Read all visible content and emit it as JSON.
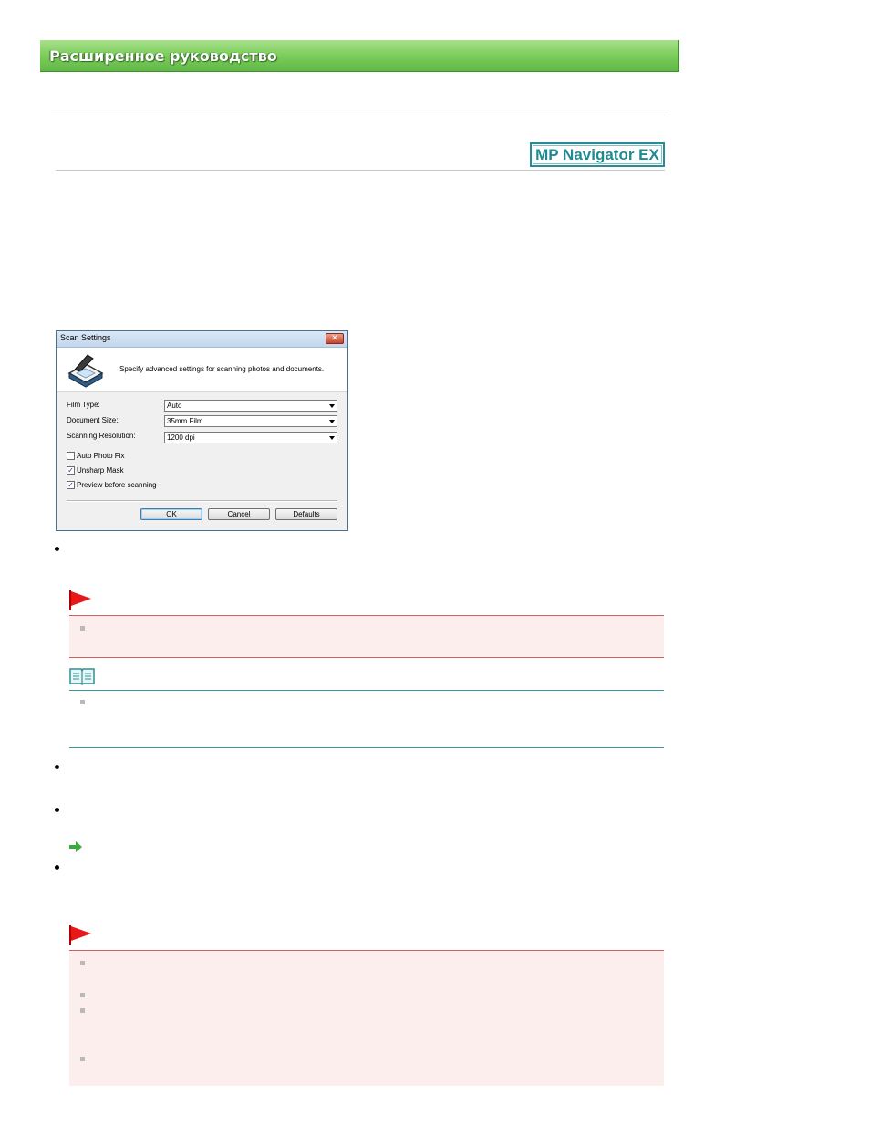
{
  "header": {
    "title": "Расширенное руководство"
  },
  "badge": {
    "label": "MP Navigator EX"
  },
  "dialog": {
    "title": "Scan Settings",
    "close_glyph": "✕",
    "description": "Specify advanced settings for scanning photos and documents.",
    "fields": [
      {
        "label": "Film Type:",
        "value": "Auto"
      },
      {
        "label": "Document Size:",
        "value": "35mm Film"
      },
      {
        "label": "Scanning Resolution:",
        "value": "1200 dpi"
      }
    ],
    "checkboxes": [
      {
        "label": "Auto Photo Fix",
        "checked": false
      },
      {
        "label": "Unsharp Mask",
        "checked": true
      },
      {
        "label": "Preview before scanning",
        "checked": true
      }
    ],
    "buttons": {
      "ok": "OK",
      "cancel": "Cancel",
      "defaults": "Defaults"
    }
  },
  "icons": {
    "caution": "caution-flag-icon",
    "note": "note-book-icon",
    "link": "green-arrow-icon",
    "scanner": "scanner-icon"
  },
  "colors": {
    "banner_green": "#7fcf5e",
    "badge_teal": "#1f8a90",
    "caution_red": "#e81818",
    "caution_bg": "#fdeeee",
    "note_teal": "#3a9aa0",
    "link_green": "#3aaa3a"
  }
}
